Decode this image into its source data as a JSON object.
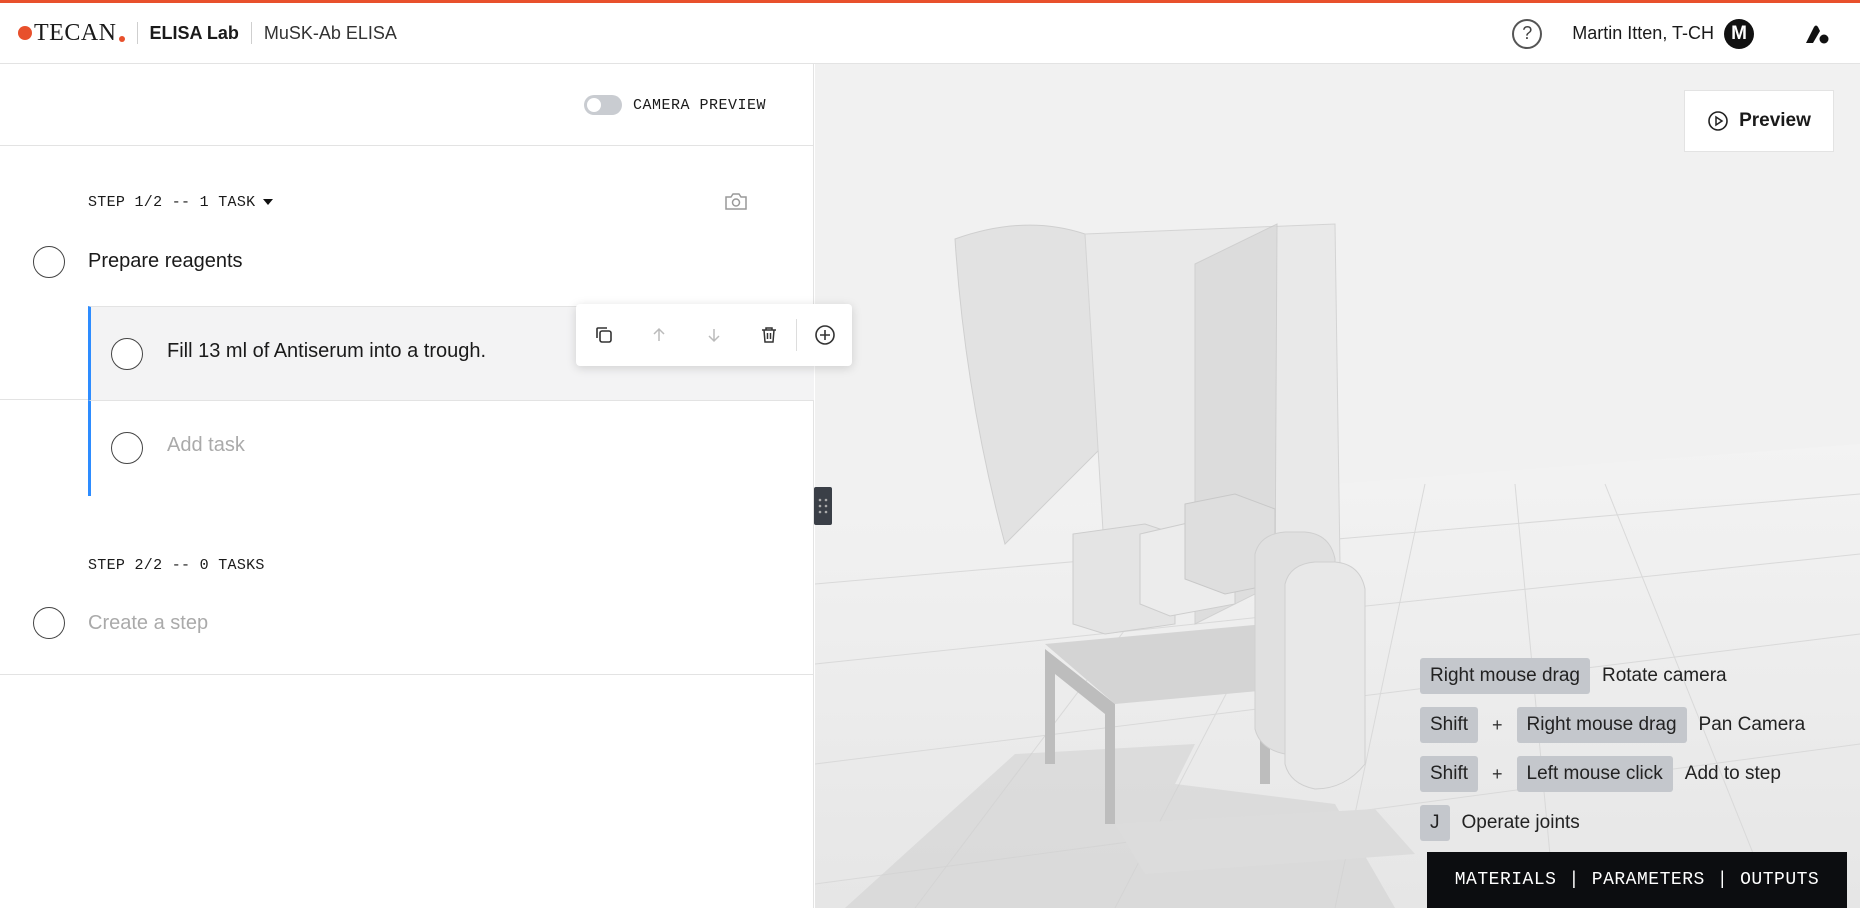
{
  "header": {
    "logo_text": "TECAN",
    "app_name": "ELISA Lab",
    "document_name": "MuSK-Ab ELISA",
    "help_glyph": "?",
    "user_name": "Martin Itten, T-CH",
    "avatar_initial": "M",
    "accent_color": "#e8502c"
  },
  "panel": {
    "camera_preview_label": "CAMERA PREVIEW",
    "camera_preview_on": false,
    "steps": [
      {
        "header": "STEP 1/2 -- 1 TASK",
        "title": "Prepare reagents",
        "tasks": [
          {
            "text": "Fill  13 ml of Antiserum into a trough."
          }
        ],
        "add_task_placeholder": "Add task"
      },
      {
        "header": "STEP 2/2 -- 0 TASKS",
        "create_step_placeholder": "Create a step"
      }
    ]
  },
  "floating_toolbar": {
    "icons": [
      "copy-icon",
      "arrow-up-icon",
      "arrow-down-icon",
      "trash-icon",
      "plus-circle-icon"
    ]
  },
  "viewport": {
    "preview_label": "Preview",
    "shortcuts": [
      {
        "keys": [
          "Right mouse drag"
        ],
        "action": "Rotate camera"
      },
      {
        "keys": [
          "Shift",
          "Right mouse drag"
        ],
        "action": "Pan Camera"
      },
      {
        "keys": [
          "Shift",
          "Left mouse click"
        ],
        "action": "Add to step"
      },
      {
        "keys": [
          "J"
        ],
        "action": "Operate joints"
      }
    ],
    "plus_glyph": "+",
    "tab_separator": "|",
    "tabs": [
      "MATERIALS",
      "PARAMETERS",
      "OUTPUTS"
    ]
  }
}
